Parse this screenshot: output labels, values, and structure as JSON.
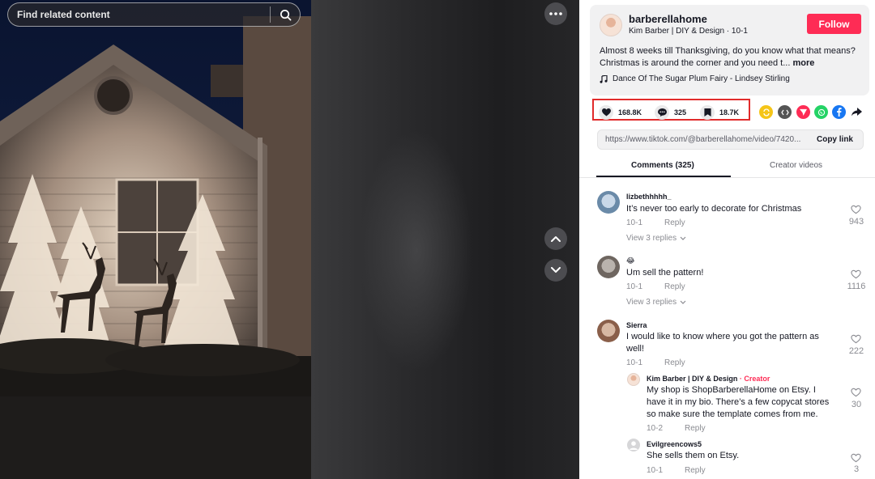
{
  "search": {
    "placeholder": "Find related content"
  },
  "author": {
    "username": "barberellahome",
    "nickname": "Kim Barber | DIY & Design · 10-1",
    "follow_label": "Follow"
  },
  "caption": {
    "text": "Almost 8 weeks till Thanksgiving, do you know what that means? Christmas is around the corner and you need t...",
    "more_label": "more"
  },
  "music": {
    "title": "Dance Of The Sugar Plum Fairy - Lindsey Stirling"
  },
  "stats": {
    "likes": "168.8K",
    "comments": "325",
    "saves": "18.7K"
  },
  "share": {
    "icons": [
      "repost-icon",
      "embed-icon",
      "send-icon",
      "whatsapp-icon",
      "facebook-icon",
      "share-arrow-icon"
    ],
    "colors": {
      "repost": "#f5c518",
      "embed": "#555555",
      "send": "#fe2c55",
      "whatsapp": "#25d366",
      "facebook": "#1877f2"
    }
  },
  "link": {
    "url": "https://www.tiktok.com/@barberellahome/video/7420...",
    "copy_label": "Copy link"
  },
  "tabs": {
    "comments": "Comments (325)",
    "creator": "Creator videos"
  },
  "comments": [
    {
      "name": "lizbethhhhh_",
      "text": "It’s never too early to decorate for Christmas",
      "date": "10-1",
      "reply": "Reply",
      "view_replies": "View 3 replies",
      "likes": "943"
    },
    {
      "name": "😂",
      "text": "Um sell the pattern!",
      "date": "10-1",
      "reply": "Reply",
      "view_replies": "View 3 replies",
      "likes": "1116"
    },
    {
      "name": "Sierra",
      "text_line1": "I would like to know where you got the pattern as",
      "text_line2": "well!",
      "date": "10-1",
      "reply": "Reply",
      "likes": "222"
    }
  ],
  "replies": [
    {
      "name": "Kim Barber | DIY & Design",
      "tag": "· Creator",
      "line1": "My shop is ShopBarberellaHome on Etsy. I",
      "line2": "have it in my bio. There’s a few copycat stores",
      "line3": "so make sure the template comes from me.",
      "date": "10-2",
      "reply": "Reply",
      "likes": "30"
    },
    {
      "name": "Evilgreencows5",
      "text": "She sells them on Etsy.",
      "date": "10-1",
      "reply": "Reply",
      "likes": "3"
    }
  ],
  "colors": {
    "accent": "#fe2c55",
    "highlight": "#e12b2b"
  }
}
